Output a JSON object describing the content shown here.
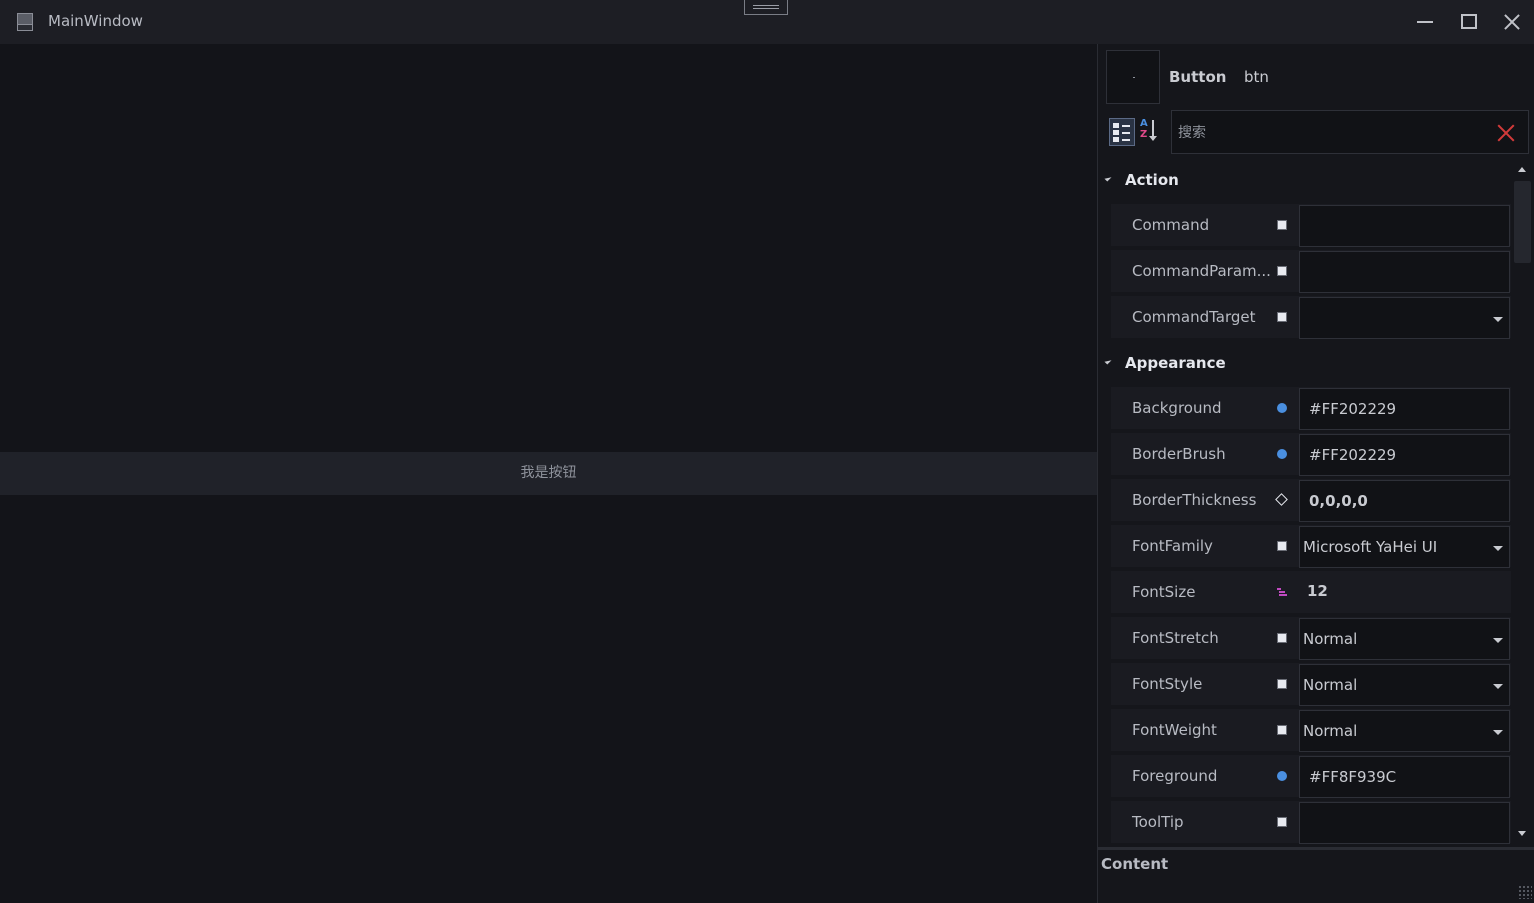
{
  "window": {
    "title": "MainWindow"
  },
  "canvas": {
    "button_label": "我是按钮"
  },
  "panel": {
    "control_type": "Button",
    "control_name": "btn",
    "search_placeholder": "搜索",
    "categories": [
      {
        "name": "Action",
        "properties": [
          {
            "name": "Command",
            "marker": "local",
            "value": "",
            "editor": "text"
          },
          {
            "name": "CommandParam...",
            "marker": "local",
            "value": "",
            "editor": "text"
          },
          {
            "name": "CommandTarget",
            "marker": "local",
            "value": "",
            "editor": "combo"
          }
        ]
      },
      {
        "name": "Appearance",
        "properties": [
          {
            "name": "Background",
            "marker": "resource",
            "value": "#FF202229",
            "editor": "text"
          },
          {
            "name": "BorderBrush",
            "marker": "resource",
            "value": "#FF202229",
            "editor": "text"
          },
          {
            "name": "BorderThickness",
            "marker": "diamond",
            "value": "0,0,0,0",
            "editor": "text-bold"
          },
          {
            "name": "FontFamily",
            "marker": "local",
            "value": "Microsoft YaHei UI",
            "editor": "combo"
          },
          {
            "name": "FontSize",
            "marker": "style",
            "value": "12",
            "editor": "plain-bold"
          },
          {
            "name": "FontStretch",
            "marker": "local",
            "value": "Normal",
            "editor": "combo"
          },
          {
            "name": "FontStyle",
            "marker": "local",
            "value": "Normal",
            "editor": "combo"
          },
          {
            "name": "FontWeight",
            "marker": "local",
            "value": "Normal",
            "editor": "combo"
          },
          {
            "name": "Foreground",
            "marker": "resource",
            "value": "#FF8F939C",
            "editor": "text"
          },
          {
            "name": "ToolTip",
            "marker": "local",
            "value": "",
            "editor": "text"
          }
        ]
      }
    ],
    "description_title": "Content"
  },
  "colors": {
    "window_bg": "#131419",
    "titlebar_bg": "#1d1e24",
    "button_bg": "#202229",
    "button_fg": "#8f939c",
    "resource_marker": "#4a8fe0",
    "clear_icon": "#d23a3a"
  }
}
